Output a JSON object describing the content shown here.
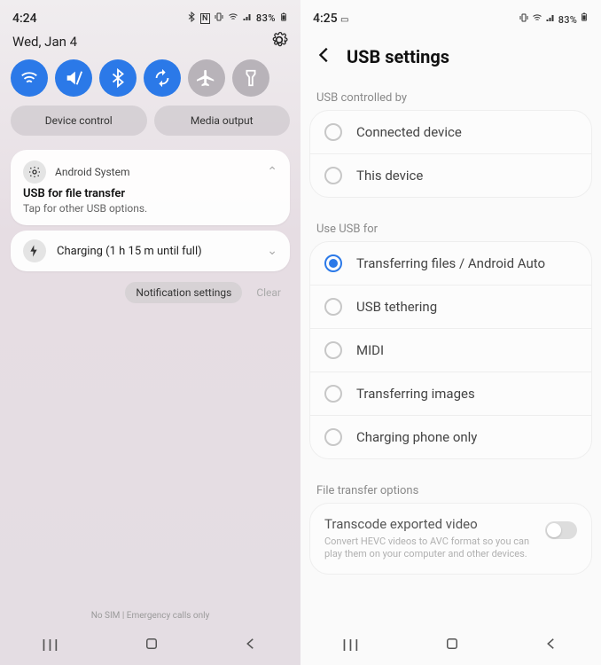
{
  "left": {
    "status": {
      "time": "4:24",
      "icons_text": "N ⚙ ▿ ◢ 83%"
    },
    "date": "Wed, Jan 4",
    "qs_toggles": [
      {
        "name": "wifi",
        "active": true
      },
      {
        "name": "mute",
        "active": true
      },
      {
        "name": "bluetooth",
        "active": true
      },
      {
        "name": "autorotate",
        "active": true
      },
      {
        "name": "airplane",
        "active": false
      },
      {
        "name": "flashlight",
        "active": false
      }
    ],
    "qs_buttons": {
      "device_control": "Device control",
      "media_output": "Media output"
    },
    "notif_system": {
      "app": "Android System",
      "title": "USB for file transfer",
      "subtitle": "Tap for other USB options."
    },
    "notif_charging": "Charging (1 h 15 m until full)",
    "actions": {
      "settings": "Notification settings",
      "clear": "Clear"
    },
    "footer": "No SIM | Emergency calls only"
  },
  "right": {
    "status": {
      "time": "4:25",
      "icons_text": "◢ ▿ ◢ 83%"
    },
    "title": "USB settings",
    "sections": {
      "controlled": "USB controlled by",
      "usefor": "Use USB for",
      "ftopts": "File transfer options"
    },
    "controlled_opts": [
      "Connected device",
      "This device"
    ],
    "usefor_opts": [
      "Transferring files / Android Auto",
      "USB tethering",
      "MIDI",
      "Transferring images",
      "Charging phone only"
    ],
    "usefor_selected": 0,
    "transcode": {
      "title": "Transcode exported video",
      "desc": "Convert HEVC videos to AVC format so you can play them on your computer and other devices."
    }
  }
}
